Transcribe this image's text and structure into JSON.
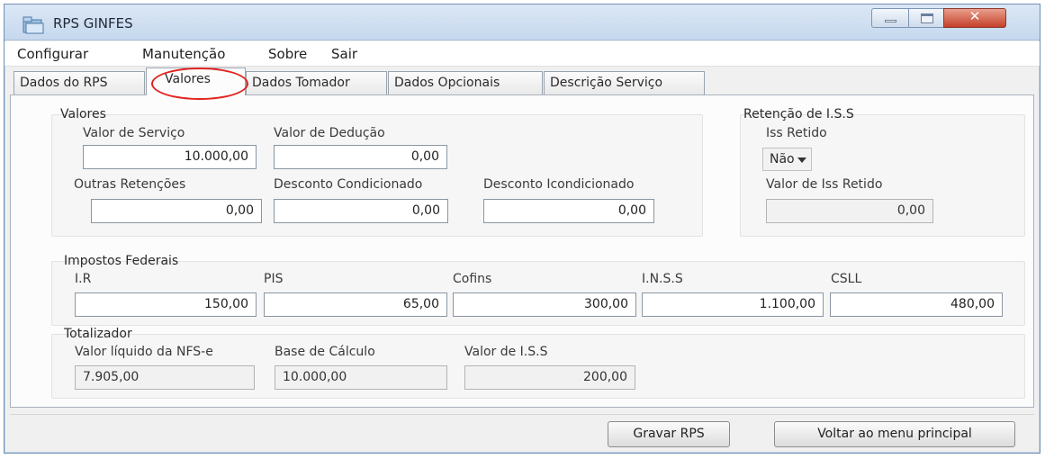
{
  "window": {
    "title": "RPS GINFES",
    "close_glyph": "✕",
    "icon": "app-folder-icon"
  },
  "menu": [
    "Configurar",
    "Manutenção",
    "Sobre",
    "Sair"
  ],
  "tabs": [
    "Dados do RPS",
    "Valores",
    "Dados Tomador",
    "Dados Opcionais",
    "Descrição Serviço"
  ],
  "active_tab": "Valores",
  "colors": {
    "highlight_circle": "#e0221f",
    "titlebar": "#c6d8ee",
    "close_button": "#c4402b"
  },
  "valores": {
    "legend": "Valores",
    "valor_servico": {
      "label": "Valor de Serviço",
      "value": "10.000,00"
    },
    "valor_deducao": {
      "label": "Valor  de Dedução",
      "value": "0,00"
    },
    "outras_retencoes": {
      "label": "Outras Retenções",
      "value": "0,00"
    },
    "desconto_condicionado": {
      "label": "Desconto Condicionado",
      "value": "0,00"
    },
    "desconto_incondicionado": {
      "label": "Desconto Icondicionado",
      "value": "0,00"
    }
  },
  "retencao": {
    "legend": "Retenção de I.S.S",
    "iss_retido_label": "Iss Retido",
    "iss_retido_value": "Não",
    "valor_iss_retido_label": "Valor  de Iss Retido",
    "valor_iss_retido_value": "0,00"
  },
  "impostos": {
    "legend": "Impostos Federais",
    "ir": {
      "label": "I.R",
      "value": "150,00"
    },
    "pis": {
      "label": "PIS",
      "value": "65,00"
    },
    "cofins": {
      "label": "Cofins",
      "value": "300,00"
    },
    "inss": {
      "label": "I.N.S.S",
      "value": "1.100,00"
    },
    "csll": {
      "label": "CSLL",
      "value": "480,00"
    }
  },
  "totalizador": {
    "legend": "Totalizador",
    "valor_liquido": {
      "label": "Valor líquido da  NFS-e",
      "value": "7.905,00"
    },
    "base_calculo": {
      "label": "Base de Cálculo",
      "value": "10.000,00"
    },
    "valor_iss": {
      "label": "Valor de I.S.S",
      "value": "200,00"
    }
  },
  "buttons": {
    "gravar": "Gravar RPS",
    "voltar": "Voltar ao menu principal"
  }
}
